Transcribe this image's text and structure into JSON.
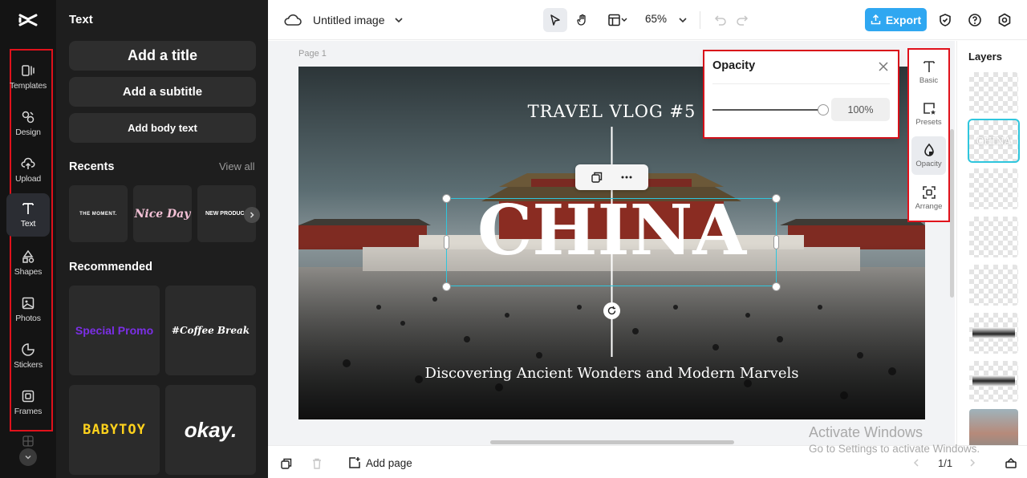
{
  "rail": {
    "items": [
      {
        "label": "Templates",
        "icon": "templates-icon"
      },
      {
        "label": "Design",
        "icon": "design-icon"
      },
      {
        "label": "Upload",
        "icon": "upload-icon"
      },
      {
        "label": "Text",
        "icon": "text-icon",
        "active": true
      },
      {
        "label": "Shapes",
        "icon": "shapes-icon"
      },
      {
        "label": "Photos",
        "icon": "photos-icon"
      },
      {
        "label": "Stickers",
        "icon": "stickers-icon"
      },
      {
        "label": "Frames",
        "icon": "frames-icon"
      }
    ]
  },
  "panel": {
    "title": "Text",
    "add_title": "Add a title",
    "add_subtitle": "Add a subtitle",
    "add_body": "Add body text",
    "recents_title": "Recents",
    "view_all": "View all",
    "recents": [
      "THE MOMENT.",
      "Nice Day",
      "NEW PRODUC"
    ],
    "recommended_title": "Recommended",
    "recommended": [
      "Special Promo",
      "#Coffee Break",
      "BABYTOY",
      "okay."
    ]
  },
  "topbar": {
    "doc_name": "Untitled image",
    "zoom": "65%",
    "export_label": "Export"
  },
  "canvas": {
    "page_label": "Page 1",
    "heading": "TRAVEL VLOG #5",
    "title": "CHINA",
    "subtitle": "Discovering Ancient Wonders and Modern Marvels"
  },
  "opacity_popover": {
    "title": "Opacity",
    "value": "100%",
    "level": 1.0
  },
  "properties": {
    "tabs": [
      {
        "label": "Basic",
        "icon": "text-basic-icon"
      },
      {
        "label": "Presets",
        "icon": "presets-icon"
      },
      {
        "label": "Opacity",
        "icon": "opacity-icon",
        "active": true
      },
      {
        "label": "Arrange",
        "icon": "arrange-icon"
      }
    ]
  },
  "layers": {
    "title": "Layers",
    "selected_layer_text": "CHINA"
  },
  "bottombar": {
    "add_page": "Add page",
    "pager": "1/1"
  },
  "watermark": {
    "line1": "Activate Windows",
    "line2": "Go to Settings to activate Windows."
  },
  "colors": {
    "accent": "#2fa7f1",
    "highlight_box": "#e0111b",
    "selection": "#2fc6dd"
  }
}
